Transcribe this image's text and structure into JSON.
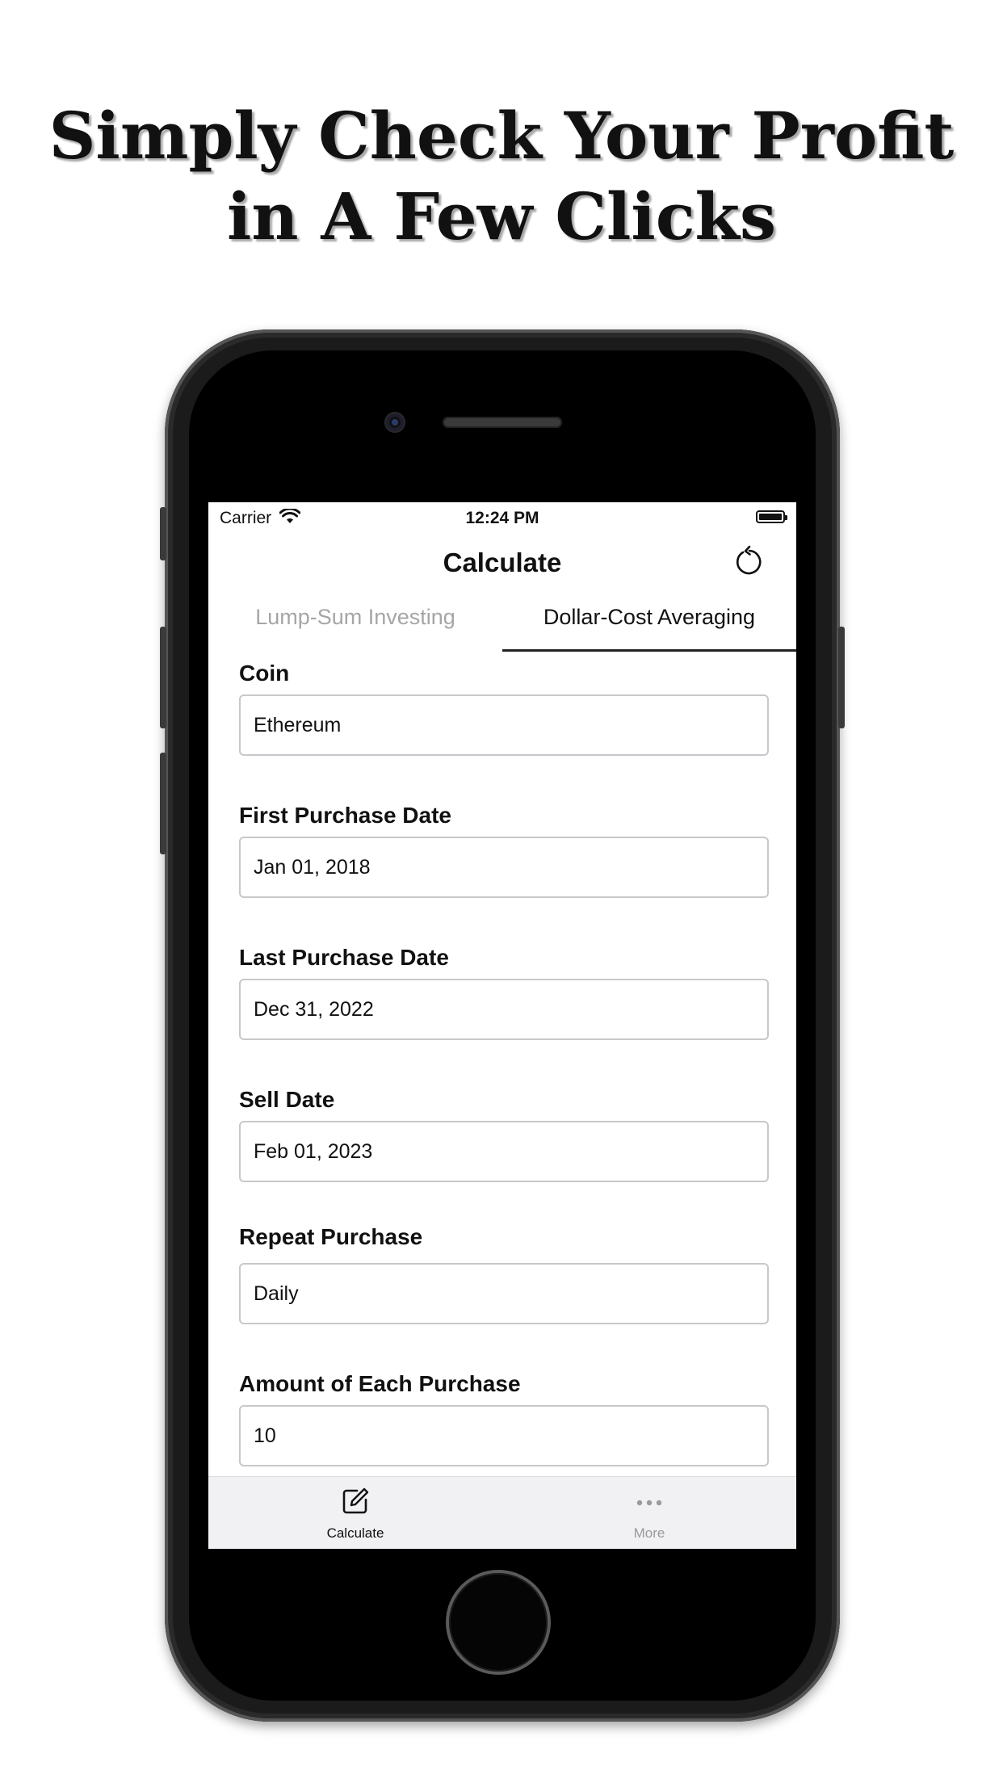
{
  "headline": {
    "line1": "Simply Check Your Profit",
    "line2": "in A Few Clicks"
  },
  "status_bar": {
    "carrier": "Carrier",
    "time": "12:24 PM"
  },
  "nav": {
    "title": "Calculate",
    "reset_icon": "reset-icon"
  },
  "tabs": [
    {
      "label": "Lump-Sum Investing",
      "selected": false
    },
    {
      "label": "Dollar-Cost Averaging",
      "selected": true
    }
  ],
  "form": {
    "fields": [
      {
        "label": "Coin",
        "value": "Ethereum"
      },
      {
        "label": "First Purchase Date",
        "value": "Jan 01, 2018"
      },
      {
        "label": "Last Purchase Date",
        "value": "Dec 31, 2022"
      },
      {
        "label": "Sell Date",
        "value": "Feb 01, 2023"
      },
      {
        "label": "Repeat Purchase",
        "value": "Daily"
      },
      {
        "label": "Amount of Each Purchase",
        "value": "10"
      }
    ]
  },
  "tab_bar": [
    {
      "label": "Calculate",
      "icon": "edit-icon",
      "active": true
    },
    {
      "label": "More",
      "icon": "ellipsis-icon",
      "active": false
    }
  ],
  "colors": {
    "accent": "#111111",
    "inactive": "#a6a6a6",
    "field_border": "#c8c8cc",
    "tab_bar_bg": "#f1f1f4"
  }
}
